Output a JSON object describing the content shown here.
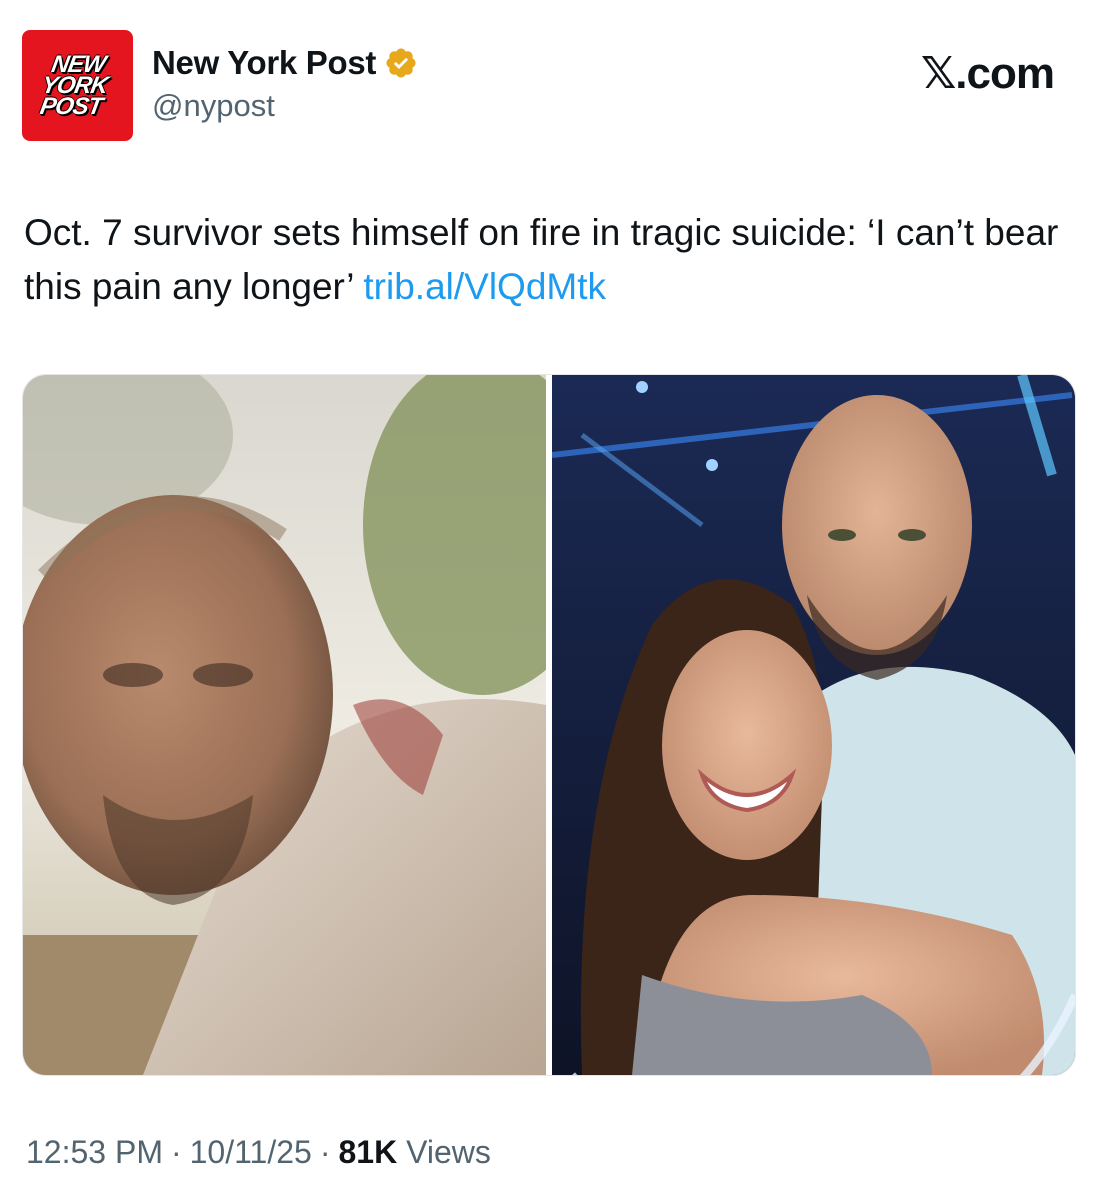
{
  "account": {
    "avatar_lines": [
      "NEW",
      "YORK",
      "POST"
    ],
    "display_name": "New York Post",
    "handle": "@nypost",
    "verified": true,
    "verified_badge_color": "#e8a81b",
    "avatar_color": "#e4151f"
  },
  "site_label": "𝕏.com",
  "tweet": {
    "text": "Oct. 7 survivor sets himself on fire in tragic suicide: ‘I can’t bear this pain any longer’",
    "link": "trib.al/VlQdMtk",
    "link_color": "#1d9bf0"
  },
  "media": {
    "count": 2
  },
  "meta": {
    "time": "12:53 PM",
    "separator": "·",
    "date": "10/11/25",
    "views_count": "81K",
    "views_label": "Views"
  }
}
